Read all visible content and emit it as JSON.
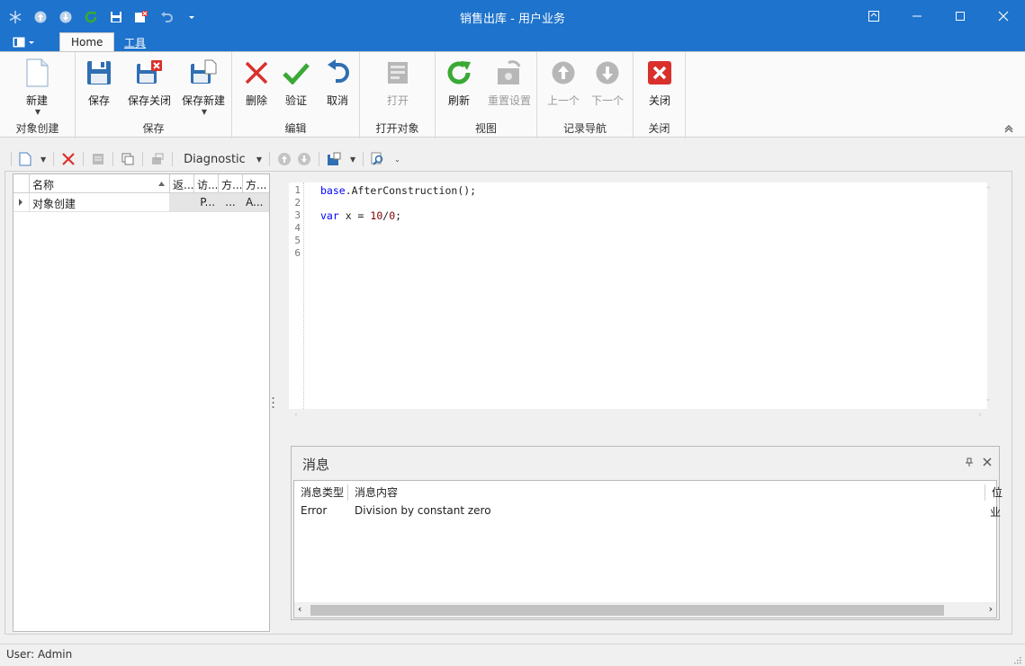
{
  "window": {
    "title": "销售出库 - 用户业务"
  },
  "ribbon": {
    "tabs": [
      {
        "label": "Home",
        "active": true
      },
      {
        "label": "工具",
        "active": false
      }
    ],
    "groups": {
      "object_create": {
        "label": "对象创建",
        "new_label": "新建"
      },
      "save": {
        "label": "保存",
        "save_label": "保存",
        "save_close_label": "保存关闭",
        "save_new_label": "保存新建"
      },
      "edit": {
        "label": "编辑",
        "delete_label": "删除",
        "validate_label": "验证",
        "cancel_label": "取消"
      },
      "open_object": {
        "label": "打开对象",
        "open_label": "打开"
      },
      "view": {
        "label": "视图",
        "refresh_label": "刷新",
        "reset_label": "重置设置"
      },
      "navigation": {
        "label": "记录导航",
        "prev_label": "上一个",
        "next_label": "下一个"
      },
      "close": {
        "label": "关闭",
        "close_label": "关闭"
      }
    }
  },
  "toolbar": {
    "dropdown_label": "Diagnostic"
  },
  "left_grid": {
    "columns": [
      "名称",
      "返...",
      "访...",
      "方...",
      "方..."
    ],
    "rows": [
      [
        "对象创建",
        "",
        "P...",
        "...",
        "A..."
      ]
    ]
  },
  "editor": {
    "line_numbers": [
      "1",
      "2",
      "3",
      "4",
      "5",
      "6"
    ],
    "line1": {
      "obj": "base",
      "rest": ".AfterConstruction();"
    },
    "line3": {
      "kw": "var",
      "mid": " x = ",
      "num1": "10",
      "slash": "/",
      "num2": "0",
      "end": ";"
    }
  },
  "messages": {
    "title": "消息",
    "columns": [
      "消息类型",
      "消息内容",
      "位"
    ],
    "rows": [
      {
        "type": "Error",
        "content": "Division by constant zero",
        "pos": "业"
      }
    ]
  },
  "status": {
    "text": "User: Admin"
  },
  "colors": {
    "titlebar": "#1e73cc",
    "accent_green": "#3aa935",
    "accent_red": "#d9302c"
  }
}
